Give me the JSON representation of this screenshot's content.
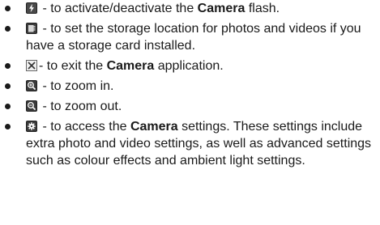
{
  "items": [
    {
      "icon": "flash-icon",
      "pre": " - to activate/deactivate the ",
      "bold": "Camera",
      "post": " flash."
    },
    {
      "icon": "storage-card-icon",
      "pre": " - to set the storage location for photos and videos if you have a storage card installed.",
      "bold": "",
      "post": ""
    },
    {
      "icon": "close-icon",
      "pre": "- to exit the ",
      "bold": "Camera",
      "post": " application."
    },
    {
      "icon": "zoom-in-icon",
      "pre": " - to zoom in.",
      "bold": "",
      "post": ""
    },
    {
      "icon": "zoom-out-icon",
      "pre": " - to zoom out.",
      "bold": "",
      "post": ""
    },
    {
      "icon": "settings-icon",
      "pre": " - to access the ",
      "bold": "Camera",
      "post": " settings. These settings include extra photo and video settings, as well as advanced settings such as colour effects and ambient light settings."
    }
  ]
}
